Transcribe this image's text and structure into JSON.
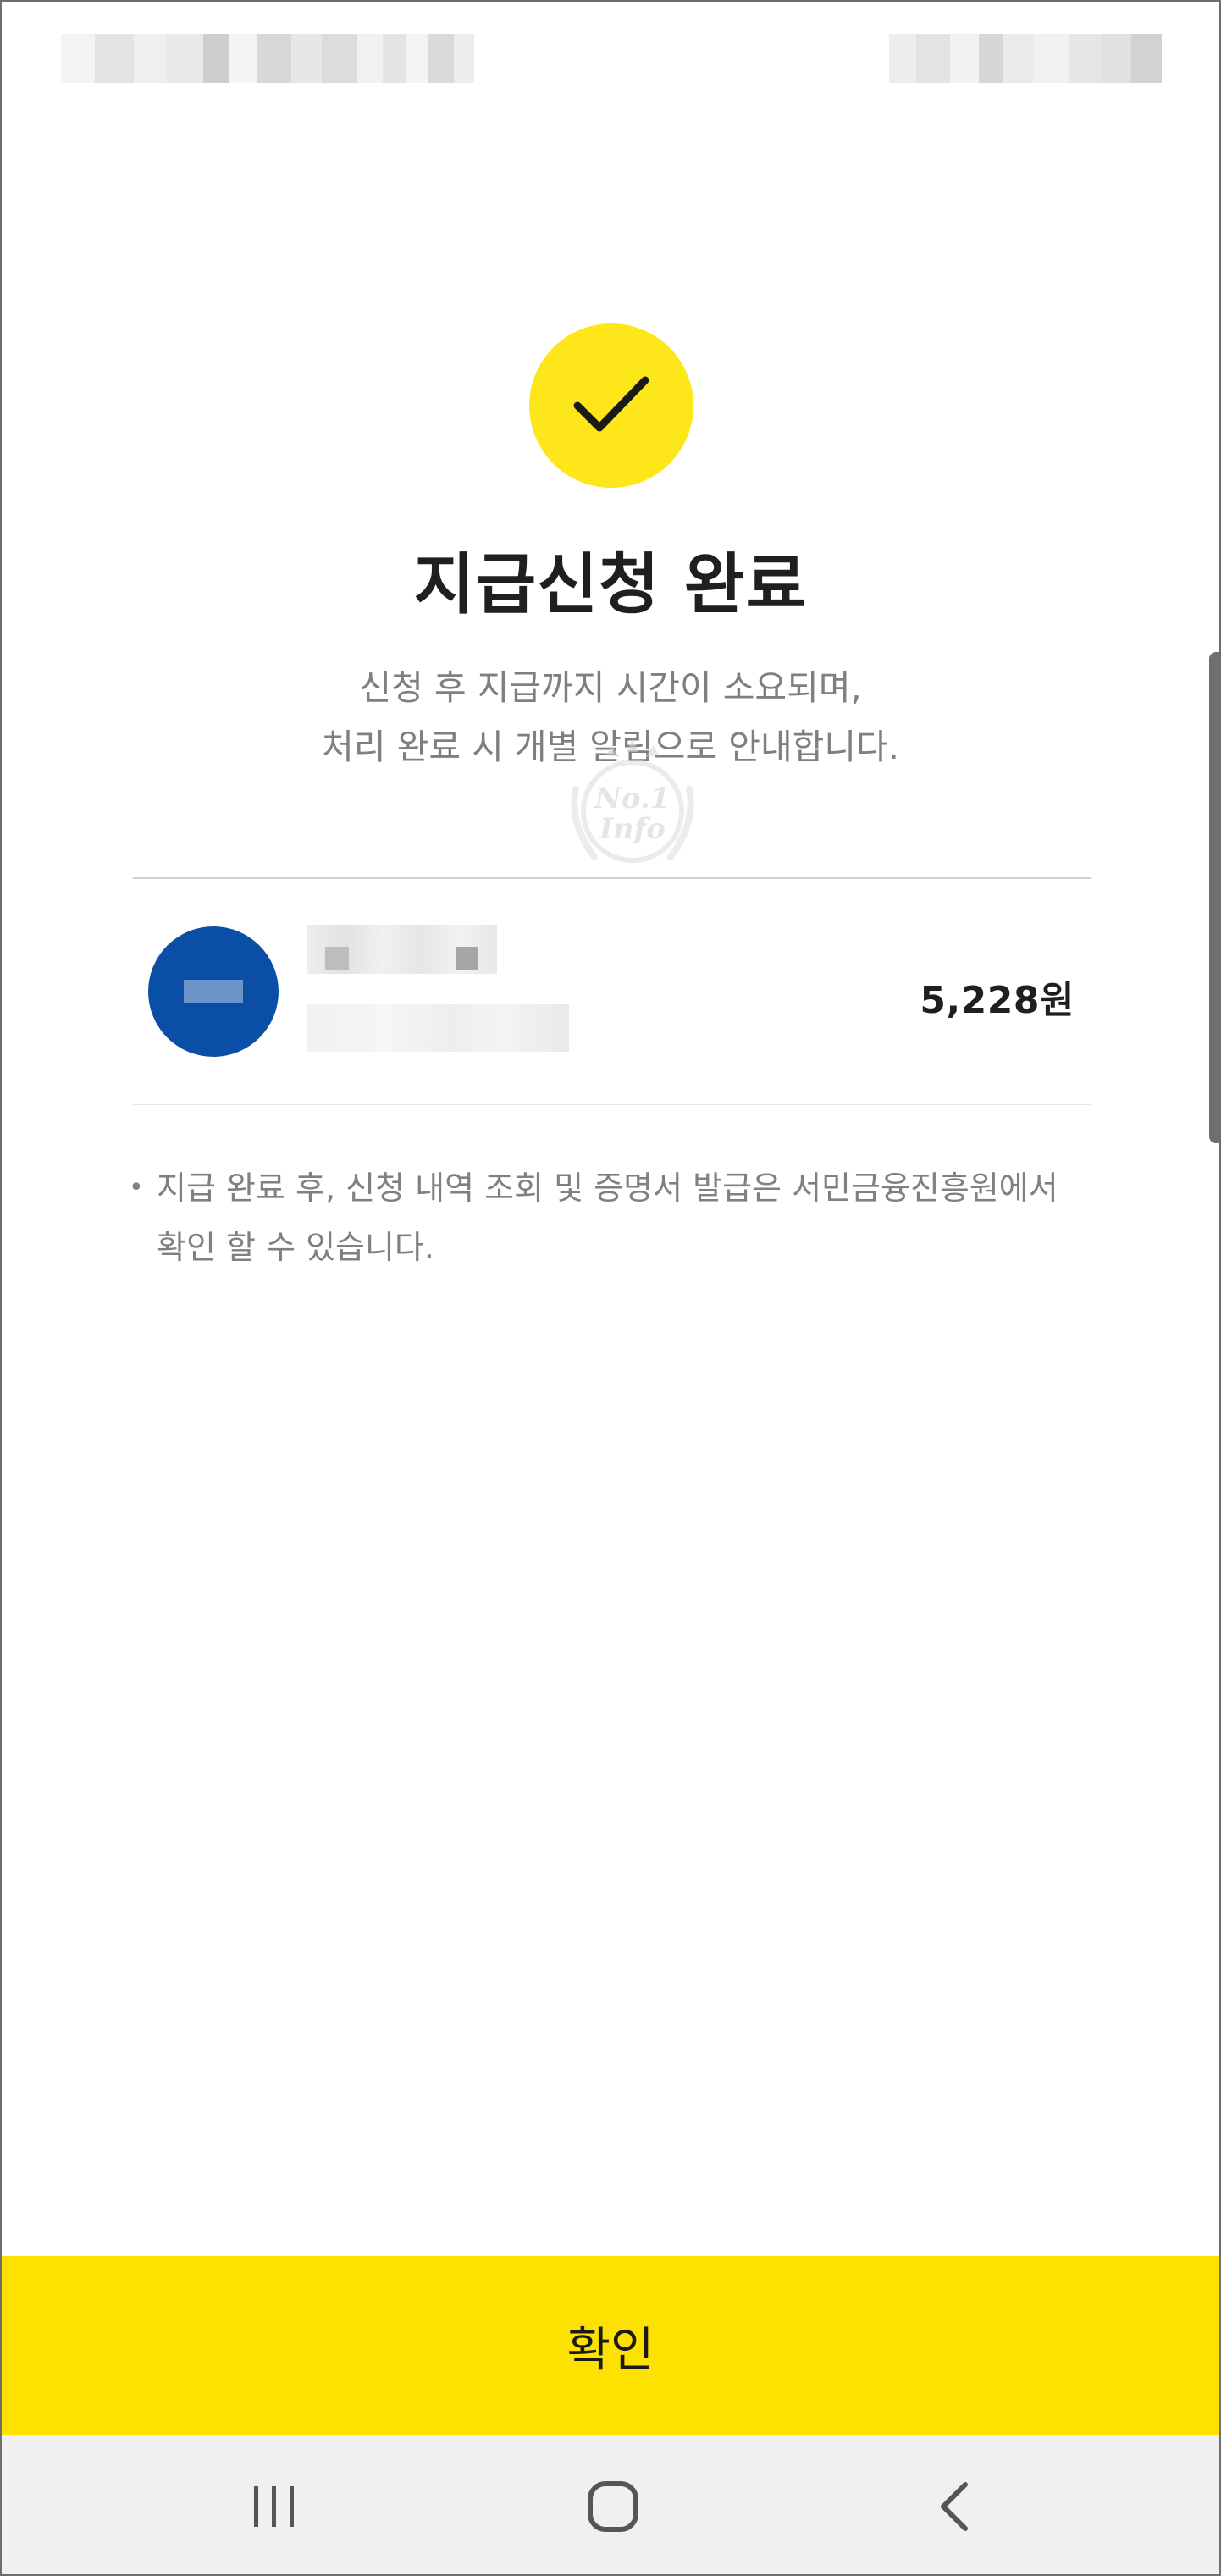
{
  "status_bar": {
    "time_redacted": true,
    "indicators_redacted": true
  },
  "success": {
    "icon": "checkmark-icon",
    "accent_color": "#fde61a",
    "title": "지급신청 완료",
    "subtitle_line1": "신청 후 지급까지 시간이 소요되며,",
    "subtitle_line2": "처리 완료 시 개별 알림으로 안내합니다."
  },
  "watermark": {
    "line1": "No.1",
    "line2": "Info"
  },
  "account": {
    "bank_logo_color": "#0a4ea5",
    "name_redacted": true,
    "number_redacted": true,
    "amount": "5,228원"
  },
  "note": {
    "bullet": "•",
    "text": "지급 완료 후, 신청 내역 조회 및 증명서 발급은 서민금융진흥원에서 확인 할 수 있습니다."
  },
  "confirm_button": {
    "label": "확인",
    "color": "#fde100"
  },
  "navigation": {
    "recent": "recent-apps-icon",
    "home": "home-icon",
    "back": "back-icon"
  }
}
